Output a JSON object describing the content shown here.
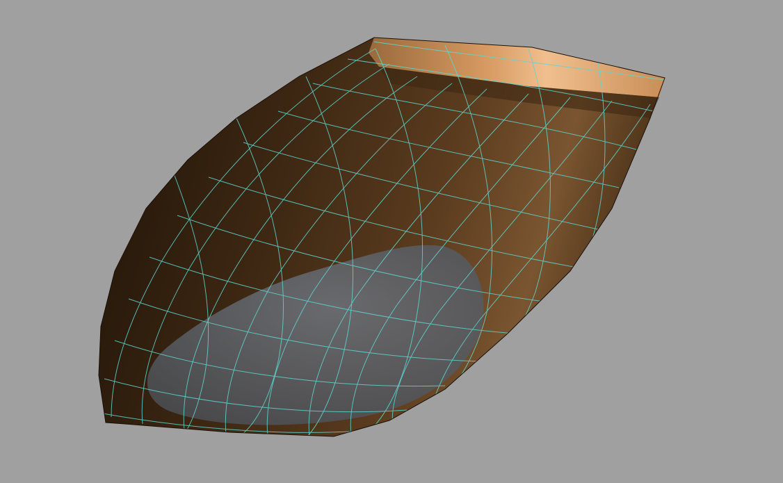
{
  "viewport": {
    "background_color": "#a0a0a0",
    "view_mode": "3d-shaded-with-wireframe"
  },
  "model": {
    "object_type": "boat-hull",
    "shading_colors": {
      "hull_light": "#e8b07a",
      "hull_mid": "#7a5530",
      "hull_dark": "#2a1a0c",
      "deck_edge": "#d79a62",
      "waterplane": "#5b5e63",
      "wireframe": "#5fd6cf"
    }
  }
}
